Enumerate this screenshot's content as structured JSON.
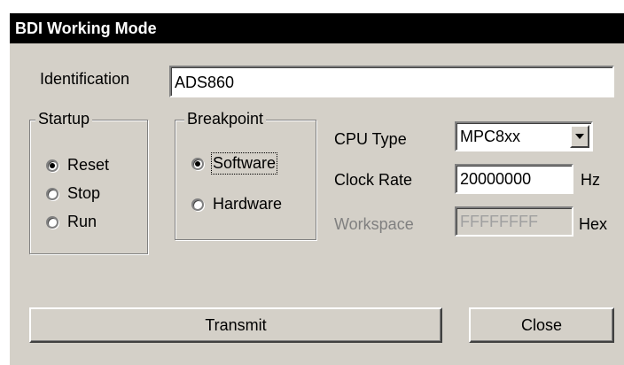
{
  "window": {
    "title": "BDI Working Mode"
  },
  "identification": {
    "label": "Identification",
    "value": "ADS860"
  },
  "startup": {
    "legend": "Startup",
    "options": [
      {
        "label": "Reset",
        "checked": true
      },
      {
        "label": "Stop",
        "checked": false
      },
      {
        "label": "Run",
        "checked": false
      }
    ]
  },
  "breakpoint": {
    "legend": "Breakpoint",
    "options": [
      {
        "label": "Software",
        "checked": true
      },
      {
        "label": "Hardware",
        "checked": false
      }
    ]
  },
  "cpu_type": {
    "label": "CPU Type",
    "value": "MPC8xx"
  },
  "clock_rate": {
    "label": "Clock Rate",
    "value": "20000000",
    "unit": "Hz"
  },
  "workspace": {
    "label": "Workspace",
    "value": "FFFFFFFF",
    "unit": "Hex",
    "disabled": true
  },
  "buttons": {
    "transmit": "Transmit",
    "close": "Close"
  },
  "colors": {
    "face": "#d4d0c8",
    "title_bg": "#000000",
    "title_fg": "#ffffff",
    "disabled_text": "#808080"
  }
}
